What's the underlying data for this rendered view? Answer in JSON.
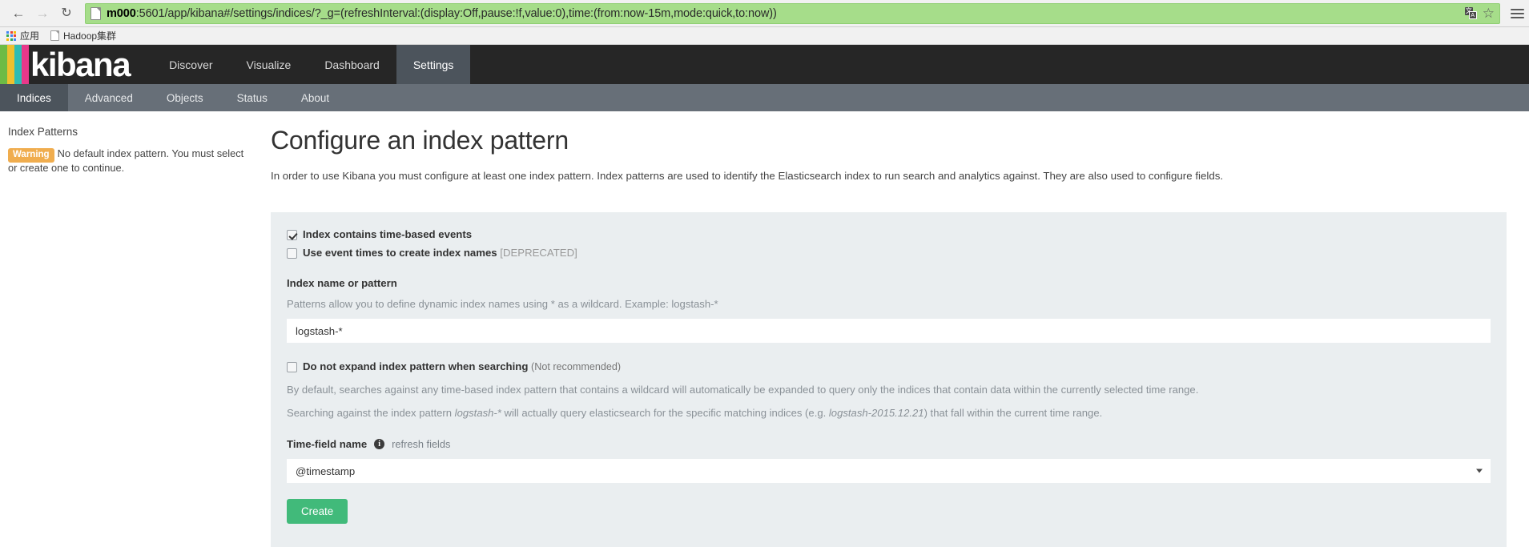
{
  "browser": {
    "back_icon": "back-arrow-icon",
    "forward_icon": "forward-arrow-icon",
    "reload_icon": "reload-icon",
    "url_host": "m000",
    "url_rest": ":5601/app/kibana#/settings/indices/?_g=(refreshInterval:(display:Off,pause:!f,value:0),time:(from:now-15m,mode:quick,to:now))",
    "url_full": "m000:5601/app/kibana#/settings/indices/?_g=(refreshInterval:(display:Off,pause:!f,value:0),time:(from:now-15m,mode:quick,to:now))",
    "translate_badge_1": "文",
    "translate_badge_2": "A",
    "star_glyph": "☆",
    "bookmarks": [
      {
        "label": "应用",
        "icon": "apps-grid-icon"
      },
      {
        "label": "Hadoop集群",
        "icon": "page-doc-icon"
      }
    ],
    "omnibox_bg": "#a6dd8a"
  },
  "kibana": {
    "brand": "kibana",
    "logo_bar_colors": [
      "#6dbb45",
      "#eec02e",
      "#2ebcb4",
      "#e8388a"
    ],
    "nav_tabs": [
      {
        "label": "Discover",
        "active": false
      },
      {
        "label": "Visualize",
        "active": false
      },
      {
        "label": "Dashboard",
        "active": false
      },
      {
        "label": "Settings",
        "active": true
      }
    ],
    "sub_tabs": [
      {
        "label": "Indices",
        "active": true
      },
      {
        "label": "Advanced",
        "active": false
      },
      {
        "label": "Objects",
        "active": false
      },
      {
        "label": "Status",
        "active": false
      },
      {
        "label": "About",
        "active": false
      }
    ]
  },
  "sidebar": {
    "title": "Index Patterns",
    "warning_badge": "Warning",
    "warning_text": "No default index pattern. You must select or create one to continue.",
    "warning_color": "#f0ad4e"
  },
  "main": {
    "title": "Configure an index pattern",
    "intro": "In order to use Kibana you must configure at least one index pattern. Index patterns are used to identify the Elasticsearch index to run search and analytics against. They are also used to configure fields.",
    "checkbox_time_based": {
      "label": "Index contains time-based events",
      "checked": true
    },
    "checkbox_event_times": {
      "label": "Use event times to create index names",
      "suffix": "[DEPRECATED]",
      "checked": false
    },
    "index_name": {
      "label": "Index name or pattern",
      "help": "Patterns allow you to define dynamic index names using * as a wildcard. Example: logstash-*",
      "value": "logstash-*",
      "placeholder": "logstash-*"
    },
    "checkbox_no_expand": {
      "label": "Do not expand index pattern when searching",
      "suffix": "(Not recommended)",
      "checked": false
    },
    "note_1": "By default, searches against any time-based index pattern that contains a wildcard will automatically be expanded to query only the indices that contain data within the currently selected time range.",
    "note_2_a": "Searching against the index pattern ",
    "note_2_em1": "logstash-*",
    "note_2_b": " will actually query elasticsearch for the specific matching indices (e.g. ",
    "note_2_em2": "logstash-2015.12.21",
    "note_2_c": ") that fall within the current time range.",
    "time_field": {
      "label": "Time-field name",
      "info_icon": "info-icon",
      "refresh_link": "refresh fields",
      "value": "@timestamp"
    },
    "create_button": "Create",
    "create_button_color": "#41ba7a",
    "panel_bg": "#eaeef0"
  }
}
